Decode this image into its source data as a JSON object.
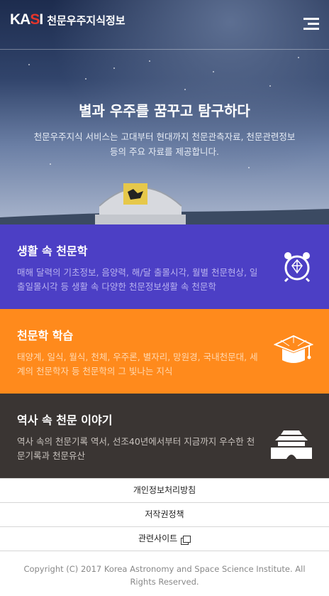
{
  "header": {
    "logo_mark": "KASI",
    "title": "천문우주지식정보"
  },
  "hero": {
    "headline": "별과 우주를 꿈꾸고 탐구하다",
    "description": "천문우주지식 서비스는 고대부터 현대까지 천문관측자료, 천문관련정보 등의 주요 자료를 제공합니다."
  },
  "cards": [
    {
      "title": "생활 속 천문학",
      "text": "매해 달력의 기초정보, 음양력, 해/달 출몰시각, 월별 천문현상, 일출일몰시각 등 생활 속 다양한 천문정보생활 속 천문학",
      "icon": "alarm-clock-icon"
    },
    {
      "title": "천문학 학습",
      "text": "태양계, 일식, 월식, 천체, 우주론, 별자리, 망원경, 국내천문대, 세계의 천문학자 등 천문학의 그 빛나는 지식",
      "icon": "graduation-cap-icon"
    },
    {
      "title": "역사 속 천문 이야기",
      "text": "역사 속의 천문기록 역서, 선조40년에서부터 지금까지 우수한 천문기록과 천문유산",
      "icon": "palace-gate-icon"
    }
  ],
  "footer": {
    "links": [
      "개인정보처리방침",
      "저작권정책",
      "관련사이트"
    ],
    "copyright": "Copyright (C) 2017 Korea Astronomy and Space Science Institute. All Rights Reserved."
  },
  "colors": {
    "card1": "#4c3fc5",
    "card2": "#ff8a1c",
    "card3": "#3a3533"
  }
}
